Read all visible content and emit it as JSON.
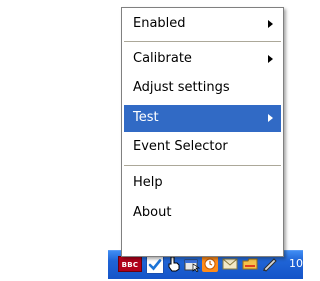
{
  "menu": {
    "items": [
      {
        "label": "Enabled",
        "submenu": true,
        "selected": false
      },
      {
        "label": "Calibrate",
        "submenu": true,
        "selected": false
      },
      {
        "label": "Adjust settings",
        "submenu": false,
        "selected": false
      },
      {
        "label": "Test",
        "submenu": true,
        "selected": true
      },
      {
        "label": "Event Selector",
        "submenu": false,
        "selected": false
      },
      {
        "label": "Help",
        "submenu": false,
        "selected": false
      },
      {
        "label": "About",
        "submenu": false,
        "selected": false
      }
    ],
    "selected_color": "#316ac5"
  },
  "taskbar": {
    "bbc_badge": "BBC",
    "clock_text": "10",
    "background_color": "#1f64d6",
    "tray_icons": [
      "bbc-icon",
      "checkmark-icon",
      "pointer-hand-icon",
      "window-cursor-icon",
      "orange-clock-icon",
      "mail-envelope-icon",
      "network-folder-icon",
      "pen-tablet-icon"
    ]
  }
}
